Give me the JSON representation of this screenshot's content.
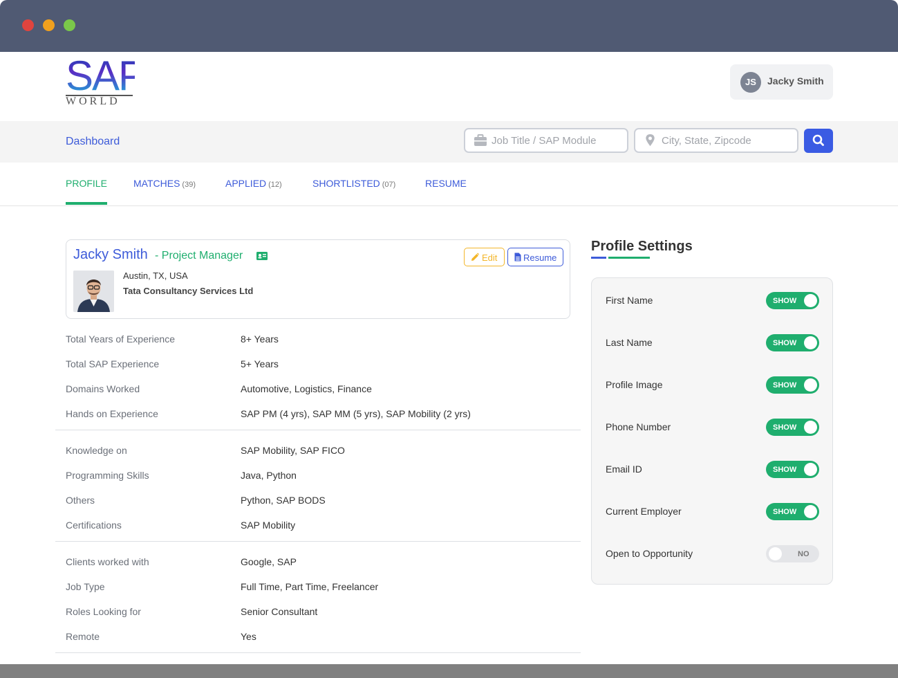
{
  "header": {
    "logo_text": "SAP",
    "logo_sub": "WORLD",
    "user_initials": "JS",
    "user_name": "Jacky Smith"
  },
  "searchbar": {
    "dashboard_label": "Dashboard",
    "job_placeholder": "Job Title / SAP Module",
    "city_placeholder": "City, State, Zipcode"
  },
  "tabs": [
    {
      "label": "PROFILE",
      "count": ""
    },
    {
      "label": "MATCHES",
      "count": "(39)"
    },
    {
      "label": "APPLIED",
      "count": "(12)"
    },
    {
      "label": "SHORTLISTED",
      "count": "(07)"
    },
    {
      "label": "RESUME",
      "count": ""
    }
  ],
  "profile": {
    "name": "Jacky Smith",
    "role": "- Project Manager",
    "location": "Austin, TX, USA",
    "company": "Tata Consultancy Services Ltd",
    "edit_label": "Edit",
    "resume_label": "Resume"
  },
  "details": [
    {
      "label": "Total Years of Experience",
      "value": "8+ Years"
    },
    {
      "label": "Total SAP Experience",
      "value": "5+ Years"
    },
    {
      "label": "Domains Worked",
      "value": "Automotive, Logistics, Finance"
    },
    {
      "label": "Hands on Experience",
      "value": "SAP PM (4 yrs), SAP MM (5 yrs), SAP Mobility (2 yrs)"
    },
    {
      "label": "Knowledge on",
      "value": "SAP Mobility, SAP FICO"
    },
    {
      "label": "Programming Skills",
      "value": "Java, Python"
    },
    {
      "label": "Others",
      "value": "Python, SAP BODS"
    },
    {
      "label": "Certifications",
      "value": "SAP Mobility"
    },
    {
      "label": "Clients worked with",
      "value": "Google, SAP"
    },
    {
      "label": "Job Type",
      "value": "Full Time, Part Time, Freelancer"
    },
    {
      "label": "Roles Looking for",
      "value": "Senior Consultant"
    },
    {
      "label": "Remote",
      "value": "Yes"
    }
  ],
  "settings": {
    "title": "Profile Settings",
    "items": [
      {
        "label": "First Name",
        "state": "SHOW"
      },
      {
        "label": "Last Name",
        "state": "SHOW"
      },
      {
        "label": "Profile Image",
        "state": "SHOW"
      },
      {
        "label": "Phone Number",
        "state": "SHOW"
      },
      {
        "label": "Email ID",
        "state": "SHOW"
      },
      {
        "label": "Current Employer",
        "state": "SHOW"
      },
      {
        "label": "Open to Opportunity",
        "state": "NO"
      }
    ]
  },
  "colors": {
    "accent_blue": "#3d5bd9",
    "accent_green": "#1fae6e",
    "edit_orange": "#f3b62a",
    "titlebar": "#505a73"
  }
}
